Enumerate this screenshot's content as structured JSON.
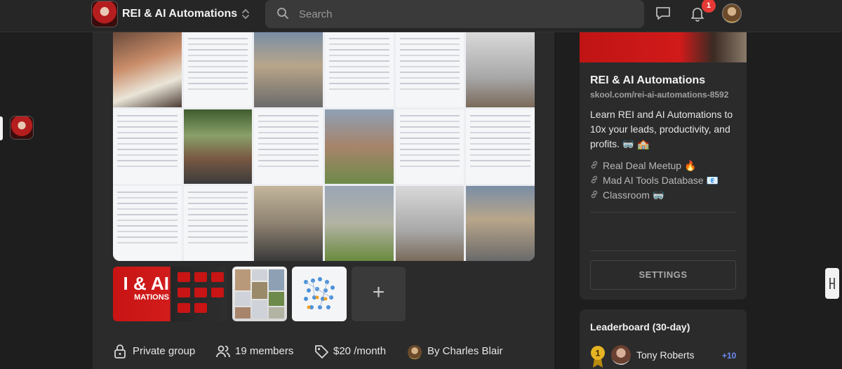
{
  "header": {
    "community_name": "REI & AI Automations",
    "search_placeholder": "Search",
    "notification_count": "1"
  },
  "main": {
    "thumbnails": {
      "thumb1_title": "I & AI",
      "thumb1_subtitle": "MATIONS",
      "add_label": "+"
    },
    "meta": {
      "privacy": "Private group",
      "members": "19 members",
      "price": "$20 /month",
      "owner": "By Charles Blair"
    }
  },
  "sidebar": {
    "title": "REI & AI Automations",
    "url": "skool.com/rei-ai-automations-8592",
    "description": "Learn REI and AI Automations to 10x your leads, productivity, and profits. 🥽 🏫",
    "links": [
      {
        "label": "Real Deal Meetup 🔥"
      },
      {
        "label": "Mad AI Tools Database 📧"
      },
      {
        "label": "Classroom 🥽"
      }
    ],
    "settings_label": "SETTINGS"
  },
  "leaderboard": {
    "title": "Leaderboard (30-day)",
    "entries": [
      {
        "rank": "1",
        "name": "Tony Roberts",
        "points": "+10"
      }
    ]
  },
  "colors": {
    "background": "#1e1e1e",
    "card": "#2b2b2b",
    "notification": "#e53935",
    "points_accent": "#6c8cf5",
    "medal": "#e6b422"
  }
}
